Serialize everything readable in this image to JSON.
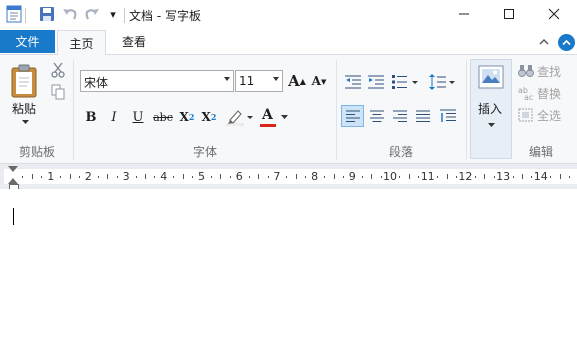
{
  "window": {
    "title": "文档 - 写字板",
    "buttons": {
      "minimize": "minimize",
      "maximize": "maximize",
      "close": "close"
    }
  },
  "quick_access": {
    "customize_label": "▾"
  },
  "ribbon_tabs": {
    "file": "文件",
    "home": "主页",
    "view": "查看"
  },
  "clipboard": {
    "paste_label": "粘贴",
    "group_label": "剪贴板"
  },
  "font": {
    "family": "宋体",
    "size": "11",
    "group_label": "字体",
    "grow_label": "A",
    "shrink_label": "A",
    "bold": "B",
    "italic": "I",
    "underline": "U",
    "strike": "abc",
    "subscript_base": "X",
    "subscript_mark": "2",
    "superscript_base": "X",
    "superscript_mark": "2",
    "font_color_label": "A",
    "font_color": "#d62718",
    "highlight_color": "#ffffff"
  },
  "paragraph": {
    "group_label": "段落"
  },
  "insert": {
    "label": "插入"
  },
  "editing": {
    "group_label": "编辑",
    "find": "查找",
    "replace": "替换",
    "select_all": "全选"
  },
  "ruler": {
    "numbers": [
      "1",
      "2",
      "3",
      "4",
      "5",
      "6",
      "7",
      "8",
      "9",
      "10",
      "11",
      "12",
      "13",
      "14"
    ]
  },
  "colors": {
    "accent": "#1979ca",
    "ribbon_bg": "#f7f8fa"
  }
}
